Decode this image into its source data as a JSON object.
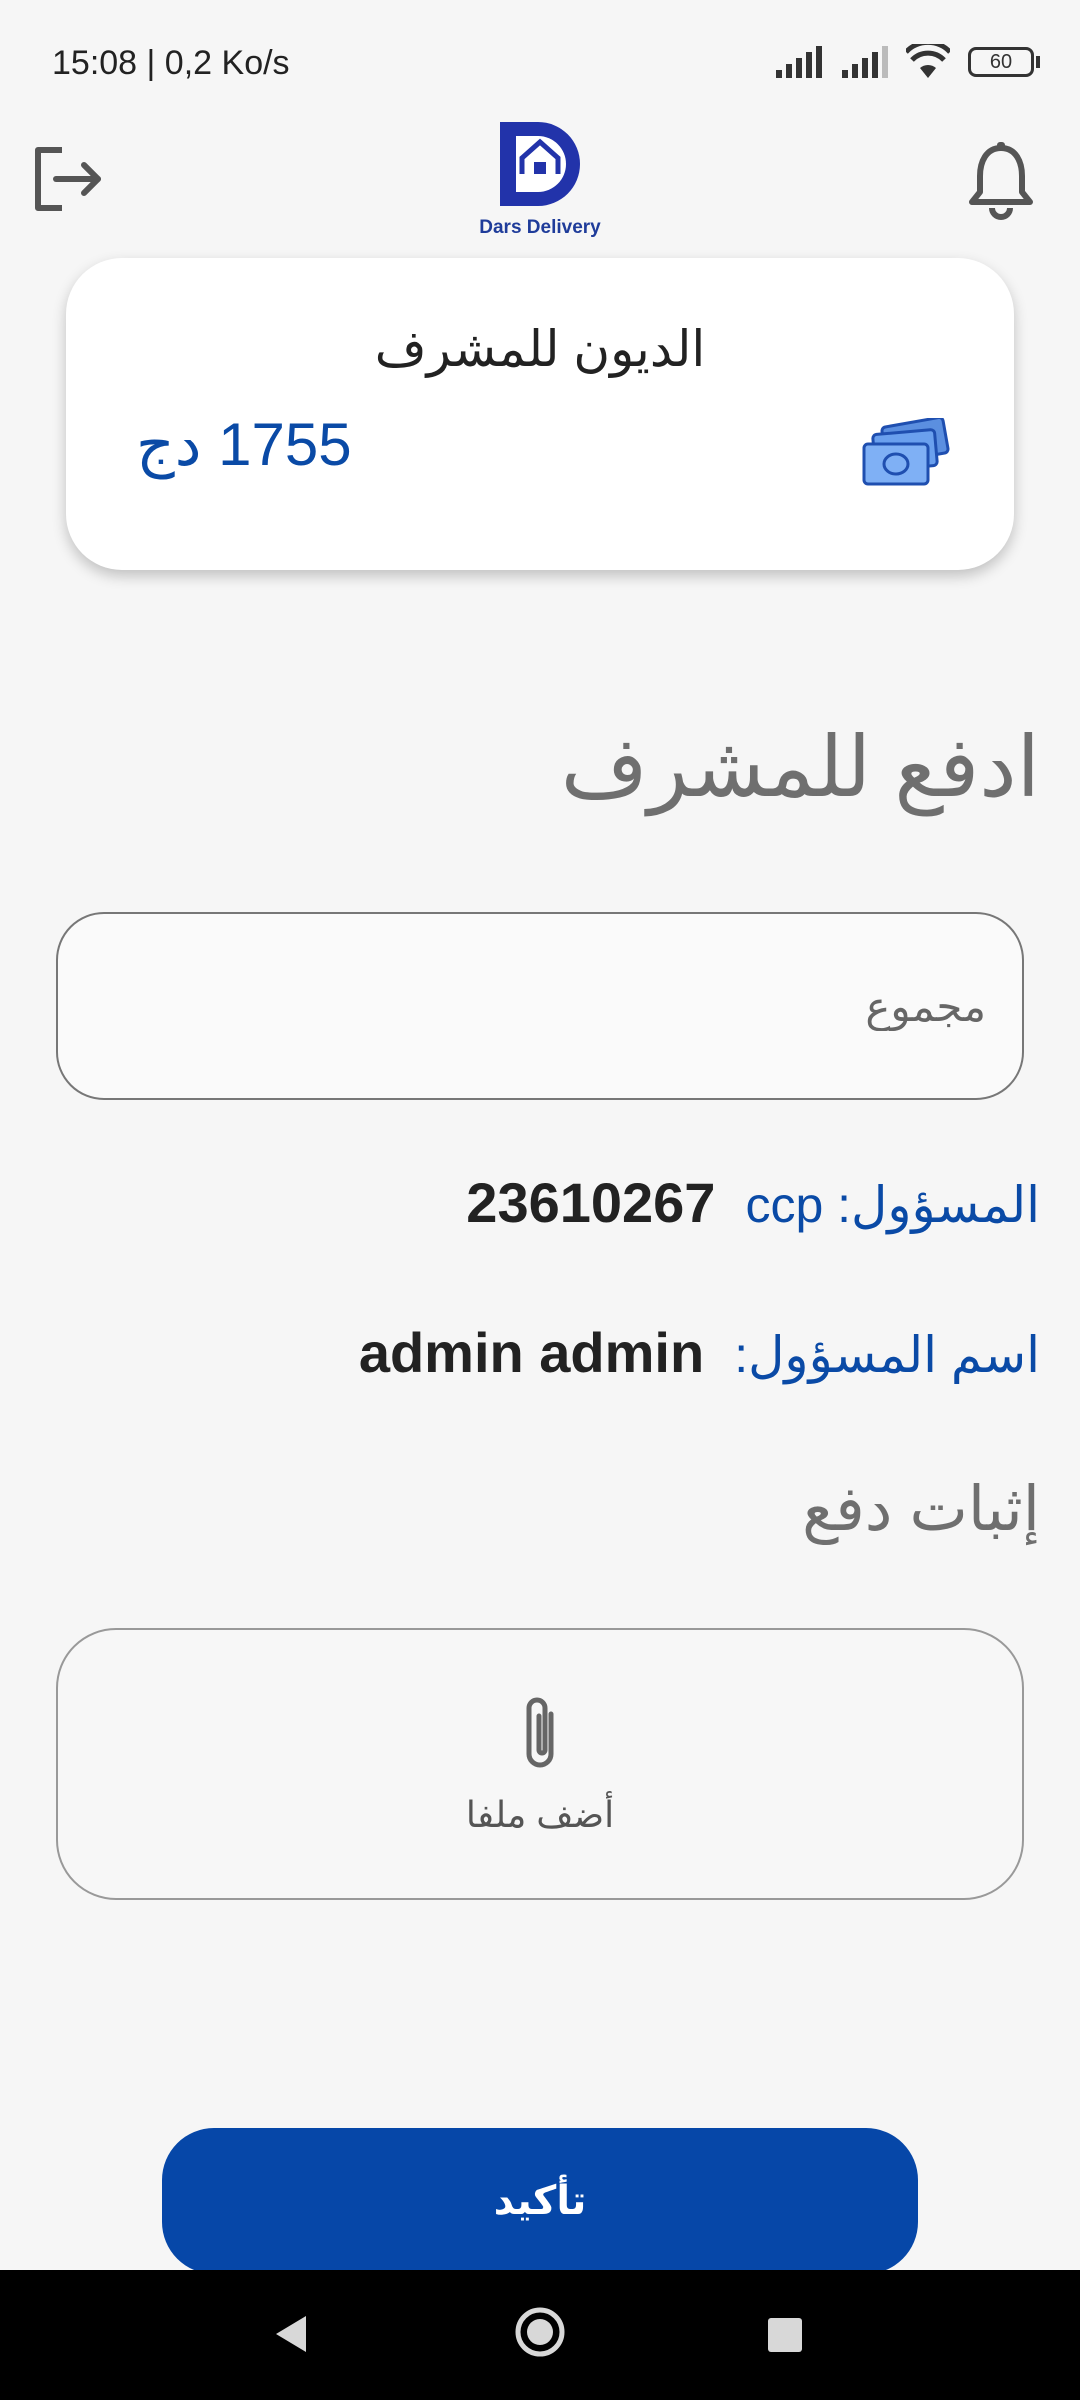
{
  "status_bar": {
    "time": "15:08 | 0,2 Ko/s",
    "battery": "60",
    "icons": [
      "bell-off-icon",
      "mosque-icon",
      "youtube-icon",
      "heart-pulse-icon",
      "signal-icon",
      "signal-icon",
      "wifi-icon",
      "battery-icon"
    ]
  },
  "app_bar": {
    "logo_text": "Dars Delivery",
    "left_icon": "logout-icon",
    "right_icon": "bell-icon"
  },
  "debt_card": {
    "title": "الديون للمشرف",
    "amount": "1755 دج",
    "icon": "money-icon"
  },
  "pay_section": {
    "title": "ادفع للمشرف",
    "amount_placeholder": "مجموع",
    "amount_value": ""
  },
  "info": {
    "ccp_label": "المسؤول: ccp",
    "ccp_value": "23610267",
    "name_label": "اسم المسؤول:",
    "name_value": "admin admin"
  },
  "proof": {
    "title": "إثبات دفع",
    "add_file_label": "أضف ملفا",
    "icon": "paperclip-icon"
  },
  "confirm_button": "تأكيد",
  "colors": {
    "primary": "#0647a8",
    "background": "#f6f6f6",
    "muted_title": "#6f6f6f"
  }
}
